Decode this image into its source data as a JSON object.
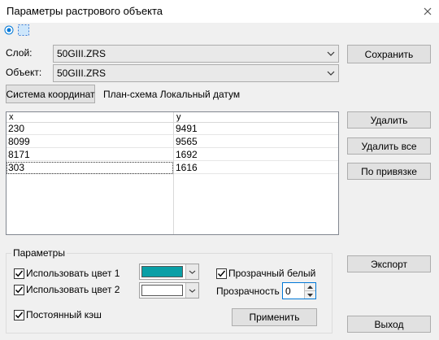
{
  "window": {
    "title": "Параметры растрового объекта"
  },
  "fields": {
    "layer_label": "Слой:",
    "layer_value": "50GIII.ZRS",
    "object_label": "Объект:",
    "object_value": "50GIII.ZRS"
  },
  "buttons": {
    "save": "Сохранить",
    "coord_system": "Система координат",
    "delete": "Удалить",
    "delete_all": "Удалить все",
    "by_binding": "По привязке",
    "export": "Экспорт",
    "apply": "Применить",
    "exit": "Выход"
  },
  "coord_system_text": "План-схема Локальный датум",
  "table": {
    "columns": [
      "x",
      "y"
    ],
    "rows": [
      [
        "230",
        "9491"
      ],
      [
        "8099",
        "9565"
      ],
      [
        "8171",
        "1692"
      ],
      [
        "303",
        "1616"
      ]
    ]
  },
  "params": {
    "group_title": "Параметры",
    "use_color_1": "Использовать цвет 1",
    "use_color_1_checked": true,
    "color_1": "#0a9fa6",
    "use_color_2": "Использовать цвет 2",
    "use_color_2_checked": true,
    "color_2": "#ffffff",
    "transparent_white": "Прозрачный белый",
    "transparent_white_checked": true,
    "transparency_label": "Прозрачность",
    "transparency_value": "0",
    "persistent_cache": "Постоянный кэш",
    "persistent_cache_checked": true
  },
  "icons": {
    "title_close": "close-icon",
    "radio": "radio-selected-icon",
    "select_tool": "dashed-selection-icon",
    "combo_arrow": "chevron-down-icon",
    "check": "checkmark-icon",
    "spin_up": "triangle-up-icon",
    "spin_down": "triangle-down-icon"
  }
}
